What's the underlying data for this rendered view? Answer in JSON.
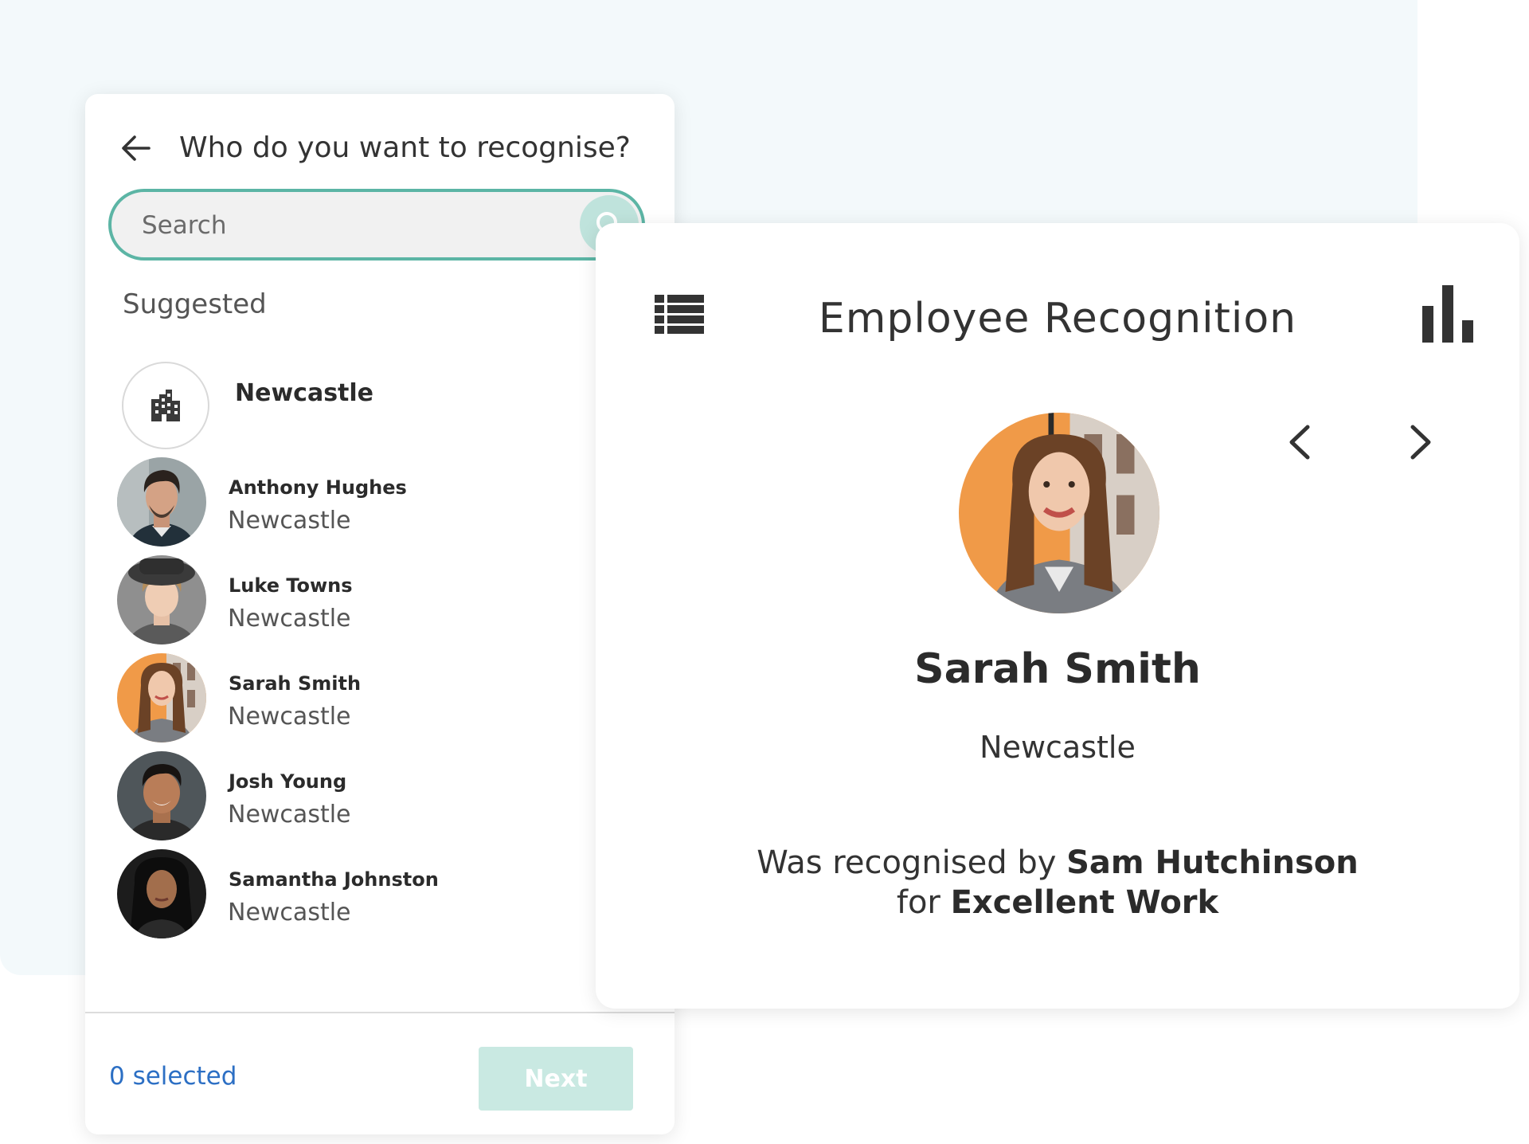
{
  "picker": {
    "title": "Who do you want to recognise?",
    "search_placeholder": "Search",
    "section_label": "Suggested",
    "group": {
      "name": "Newcastle",
      "icon": "building-icon"
    },
    "people": [
      {
        "name": "Anthony Hughes",
        "location": "Newcastle"
      },
      {
        "name": "Luke Towns",
        "location": "Newcastle"
      },
      {
        "name": "Sarah Smith",
        "location": "Newcastle"
      },
      {
        "name": "Josh Young",
        "location": "Newcastle"
      },
      {
        "name": "Samantha Johnston",
        "location": "Newcastle"
      }
    ],
    "selected_count": "0 selected",
    "next_label": "Next"
  },
  "card": {
    "title": "Employee Recognition",
    "employee_name": "Sarah Smith",
    "employee_location": "Newcastle",
    "recognition_prefix": "Was recognised by",
    "recognised_by": "Sam Hutchinson",
    "recognition_for_word": "for",
    "award": "Excellent Work"
  },
  "colors": {
    "accent": "#5cb5a5",
    "accent_light": "#c9e9e2",
    "link_blue": "#2c6fc4",
    "background_tint": "#f3f9fb"
  }
}
